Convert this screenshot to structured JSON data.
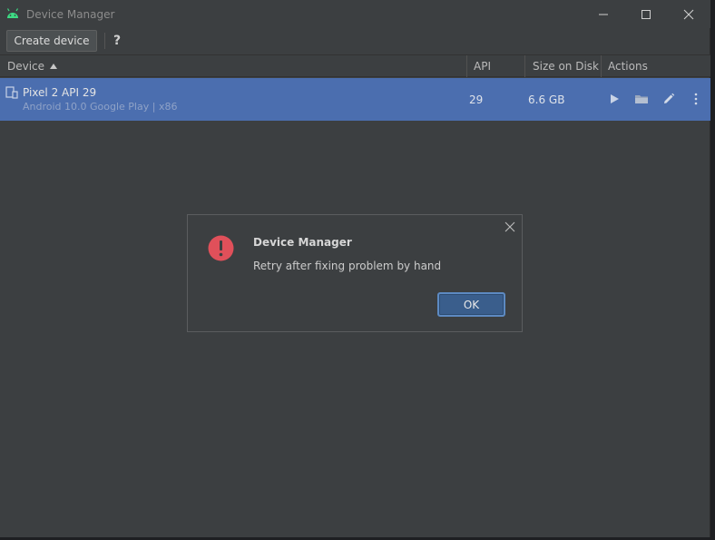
{
  "window": {
    "title": "Device Manager",
    "icon": "android-icon"
  },
  "toolbar": {
    "create_label": "Create device",
    "help_label": "?"
  },
  "table": {
    "headers": {
      "device": "Device",
      "api": "API",
      "size": "Size on Disk",
      "actions": "Actions"
    },
    "sort_column": "Device",
    "sort_direction": "ascending",
    "rows": [
      {
        "name": "Pixel 2 API 29",
        "subtitle": "Android 10.0 Google Play | x86",
        "api": "29",
        "size": "6.6 GB",
        "selected": true
      }
    ]
  },
  "dialog": {
    "title": "Device Manager",
    "message": "Retry after fixing problem by hand",
    "ok_label": "OK",
    "icon": "error-icon"
  },
  "colors": {
    "background": "#3c3f41",
    "selection": "#4b6eaf",
    "accent_android": "#3ddc84",
    "error": "#e0505a"
  }
}
